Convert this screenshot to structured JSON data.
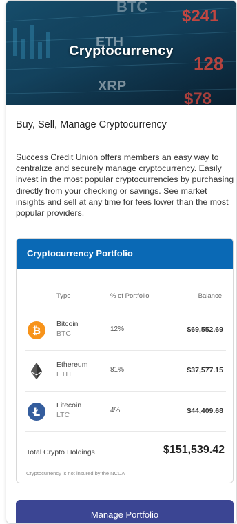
{
  "hero": {
    "title": "Cryptocurrency",
    "bg_tickers": [
      "BTC",
      "$241",
      "ETH",
      "128",
      "XRP",
      "$78"
    ]
  },
  "subtitle": "Buy, Sell, Manage Cryptocurrency",
  "description": "Success Credit Union offers members an easy way to centralize and securely manage cryptocurrency. Easily invest in the most popular cryptocurrencies by purchasing directly from your checking or savings. See market insights and sell at any time for fees lower than the most popular providers.",
  "portfolio": {
    "title": "Cryptocurrency Portfolio",
    "columns": {
      "type": "Type",
      "percent": "% of Portfolio",
      "balance": "Balance"
    },
    "rows": [
      {
        "name": "Bitcoin",
        "symbol": "BTC",
        "percent": "12%",
        "balance": "$69,552.69",
        "icon": "bitcoin-icon",
        "color": "#f7931a"
      },
      {
        "name": "Ethereum",
        "symbol": "ETH",
        "percent": "81%",
        "balance": "$37,577.15",
        "icon": "ethereum-icon",
        "color": "#333333"
      },
      {
        "name": "Litecoin",
        "symbol": "LTC",
        "percent": "4%",
        "balance": "$44,409.68",
        "icon": "litecoin-icon",
        "color": "#345d9d"
      }
    ],
    "total_label": "Total Crypto Holdings",
    "total_value": "$151,539.42",
    "disclaimer": "Cryptocurrency is not insured by the NCUA"
  },
  "manage_button": "Manage Portfolio",
  "colors": {
    "header_blue": "#0a69b5",
    "button_indigo": "#3b4593",
    "bitcoin_orange": "#f7931a",
    "litecoin_blue": "#345d9d"
  }
}
